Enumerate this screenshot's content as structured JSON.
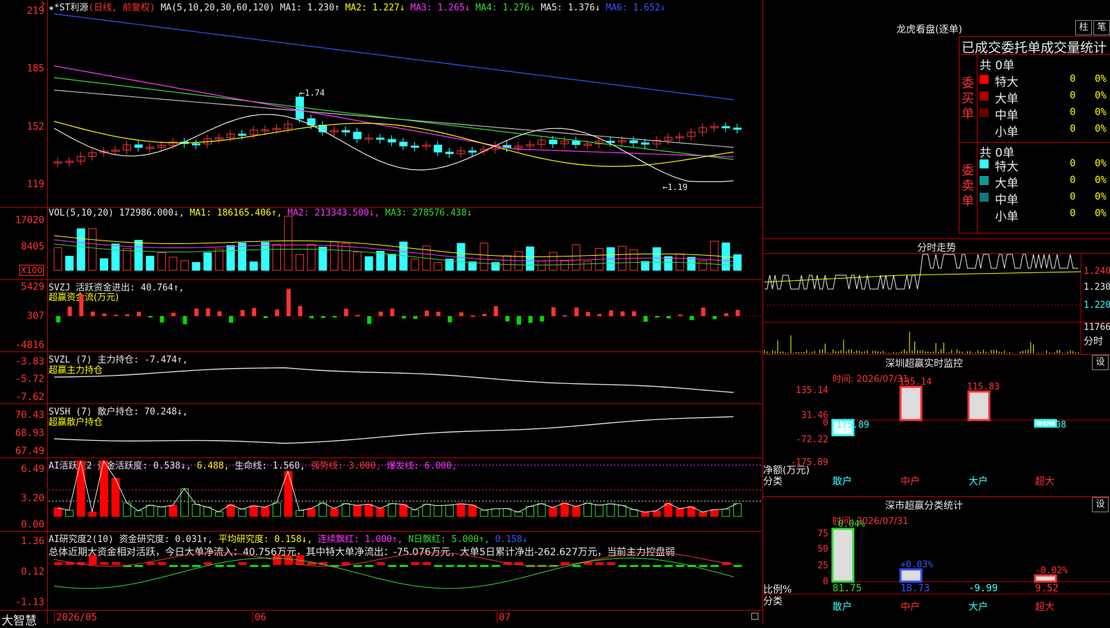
{
  "main": {
    "stock_header": "★*ST利源",
    "chart_mode": "(日线, 前复权)",
    "ma_label": "MA(5,10,20,30,60,120)",
    "ma_values": [
      {
        "text": "MA1: 1.230↑",
        "color": "#e8e8e8"
      },
      {
        "text": "MA2: 1.227↓",
        "color": "#ffff00"
      },
      {
        "text": "MA3: 1.265↓",
        "color": "#ff33ff"
      },
      {
        "text": "MA4: 1.276↓",
        "color": "#33dd33"
      },
      {
        "text": "MA5: 1.376↓",
        "color": "#e8e8e8"
      },
      {
        "text": "MA6: 1.652↓",
        "color": "#3355ff"
      }
    ],
    "y_ticks": [
      "219",
      "185",
      "152",
      "119"
    ],
    "annotation_high": "1.74",
    "annotation_low": "1.19",
    "top_marker": "?"
  },
  "vol": {
    "header": "VOL(5,10,20)",
    "value": "172986.000↓,",
    "ma1": "MA1: 186165.406↑,",
    "ma2": "MA2: 213343.500↓,",
    "ma3": "MA3: 278576.438↓",
    "y_ticks": [
      "17020",
      "8405"
    ],
    "unit": "X100"
  },
  "svzj": {
    "header": "SVZJ  活跃资金进出: 40.764↑,",
    "sub": "超赢资金流(万元)",
    "y_ticks": [
      "5429",
      "307",
      "-4816"
    ]
  },
  "svzl": {
    "header": "SVZL (7) 主力持仓: -7.474↑,",
    "sub": "超赢主力持仓",
    "y_ticks": [
      "-3.83",
      "-5.72",
      "-7.62"
    ]
  },
  "svsh": {
    "header": "SVSH (7) 散户持仓: 70.248↓,",
    "sub": "超赢散户持仓",
    "y_ticks": [
      "70.43",
      "68.93",
      "67.49"
    ]
  },
  "ai1": {
    "header": "AI活跃度2 资金活跃度: 0.538↓,",
    "v2": "6.488,",
    "v3": "生命线: 1.560,",
    "v4": "强势线: 3.000,",
    "v5": "爆发线: 6.000,",
    "y_ticks": [
      "6.49",
      "3.20",
      "0.00"
    ]
  },
  "ai2": {
    "header": "AI研究度2(10) 资金研究度: 0.031↑,",
    "avg": "平均研究度: 0.158↓,",
    "streak": "连续飘红: 1.000↑,",
    "nday": "N日飘红: 5.000↑,",
    "last": "0.158↓",
    "summary": "总体近期大资金相对活跃，今日大单净流入：40.756万元，其中特大单净流出：-75.076万元，大单5日累计净出-262.627万元，当前主力控盘弱",
    "y_ticks": [
      "1.36",
      "0.12",
      "-1.13"
    ]
  },
  "xaxis": {
    "brand": "大智慧",
    "labels": [
      "2026/05",
      "06",
      "07"
    ]
  },
  "longhu": {
    "title": "龙虎看盘(逐单)",
    "btn_col": "柱",
    "btn_pen": "笔",
    "table_title": "已成交委托单成交量统计",
    "buy": {
      "label": "委买单",
      "total": "共 0单",
      "rows": [
        {
          "name": "特大",
          "count": "0",
          "pct": "0%",
          "color": "#ff0000"
        },
        {
          "name": "大单",
          "count": "0",
          "pct": "0%",
          "color": "#aa0000"
        },
        {
          "name": "中单",
          "count": "0",
          "pct": "0%",
          "color": "#660000"
        },
        {
          "name": "小单",
          "count": "0",
          "pct": "0%",
          "color": ""
        }
      ]
    },
    "sell": {
      "label": "委卖单",
      "total": "共 0单",
      "rows": [
        {
          "name": "特大",
          "count": "0",
          "pct": "0%",
          "color": "#33ffff"
        },
        {
          "name": "大单",
          "count": "0",
          "pct": "0%",
          "color": "#119999"
        },
        {
          "name": "中单",
          "count": "0",
          "pct": "0%",
          "color": "#117777"
        },
        {
          "name": "小单",
          "count": "0",
          "pct": "0%",
          "color": ""
        }
      ]
    }
  },
  "intraday": {
    "title": "分时走势",
    "prices": [
      "1.240",
      "1.230",
      "1.220"
    ],
    "vol": "11766",
    "vol_label": "分时"
  },
  "monitor": {
    "title": "深圳超赢实时监控",
    "set": "设",
    "time": "时间: 2026/07/31",
    "y_ticks": [
      "135.14",
      "31.46",
      "0",
      "-72.22",
      "-175.89"
    ],
    "net_label": "净额(万元)",
    "class_label": "分类",
    "bars": [
      {
        "name": "散户",
        "value": -175.89,
        "label": "-175.89"
      },
      {
        "name": "中户",
        "value": 135.14,
        "label": "135.14"
      },
      {
        "name": "大户",
        "value": 115.83,
        "label": "115.83"
      },
      {
        "name": "超大",
        "value": -75.08,
        "label": "-75.08"
      }
    ]
  },
  "classstats": {
    "title": "深市超赢分类统计",
    "set": "设",
    "time": "时间: 2026/07/31",
    "y_ticks": [
      "75",
      "50",
      "25",
      "0"
    ],
    "ratio_label": "比例%",
    "class_label": "分类",
    "items": [
      {
        "name": "散户",
        "value": "81.75",
        "pct": 81.75,
        "delta": "-0.04%",
        "color": "#33dd33"
      },
      {
        "name": "中户",
        "value": "18.73",
        "pct": 18.73,
        "delta": "+0.03%",
        "color": "#3355ff"
      },
      {
        "name": "大户",
        "value": "-9.99",
        "pct": 0,
        "delta": "",
        "color": "#33ffff"
      },
      {
        "name": "超大",
        "value": "9.52",
        "pct": 9.52,
        "delta": "-0.02%",
        "color": "#ff3333"
      }
    ]
  }
}
